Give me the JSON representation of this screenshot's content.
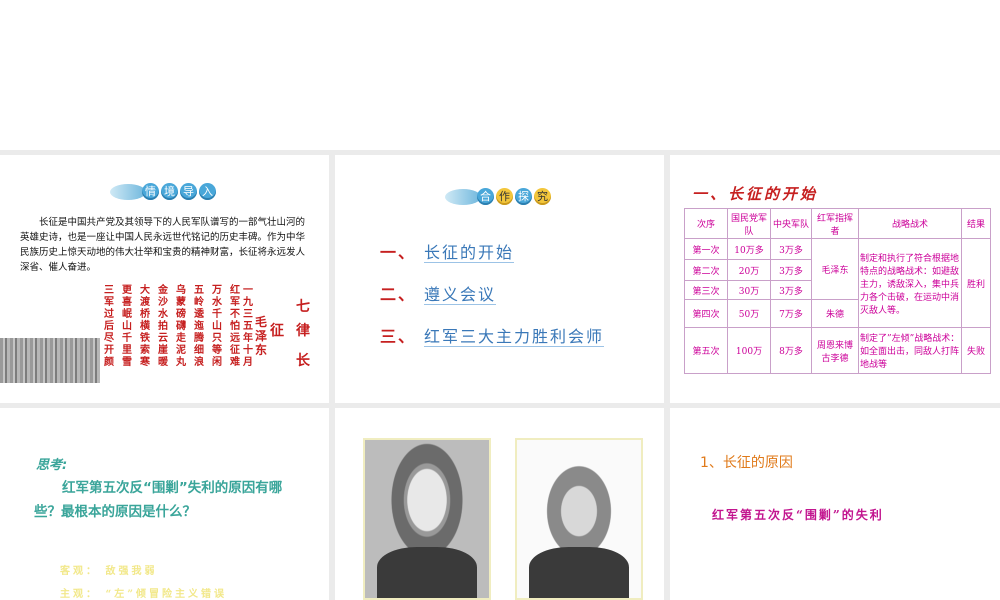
{
  "slide1": {
    "badge": [
      "情",
      "境",
      "导",
      "入"
    ],
    "intro": "长征是中国共产党及其领导下的人民军队谱写的一部气壮山河的英雄史诗，也是一座让中国人民永远世代铭记的历史丰碑。作为中华民族历史上惊天动地的伟大壮举和宝贵的精神财富，长征将永远发人深省、催人奋进。",
    "poem_title_a": "七律",
    "poem_title_b": "长征",
    "poem_author": "毛泽东",
    "poem_date": "一九三五年十月",
    "poem_lines": [
      "红军不怕远征难",
      "万水千山只等闲",
      "五岭逶迤腾细浪",
      "乌蒙磅礴走泥丸",
      "金沙水拍云崖暖",
      "大渡桥横铁索寒",
      "更喜岷山千里雪",
      "三军过后尽开颜"
    ]
  },
  "slide2": {
    "badge": [
      "合",
      "作",
      "探",
      "究"
    ],
    "items": [
      {
        "num": "一、",
        "text": "长征的开始"
      },
      {
        "num": "二、",
        "text": "遵义会议"
      },
      {
        "num": "三、",
        "text": "红军三大主力胜利会师"
      }
    ]
  },
  "slide3": {
    "title": "一、长征的开始",
    "headers": [
      "次序",
      "国民党军队",
      "中央军队",
      "红军指挥者",
      "战略战术",
      "结果"
    ],
    "rows": [
      {
        "order": "第一次",
        "kmt": "10万多",
        "central": "3万多"
      },
      {
        "order": "第二次",
        "kmt": "20万",
        "central": "3万多"
      },
      {
        "order": "第三次",
        "kmt": "30万",
        "central": "3万多"
      },
      {
        "order": "第四次",
        "kmt": "50万",
        "central": "7万多"
      },
      {
        "order": "第五次",
        "kmt": "100万",
        "central": "8万多"
      }
    ],
    "commander_mao": "毛泽东",
    "commander_zhu": "朱德",
    "commander_five": "周恩来博古李德",
    "tactics_good": "制定和执行了符合根据地特点的战略战术：如避敌主力，诱敌深入，集中兵力各个击破，在运动中消灭敌人等。",
    "tactics_bad": "制定了”左倾”战略战术：如全面出击，同敌人打阵地战等",
    "result_win": "胜利",
    "result_lose": "失败"
  },
  "slide4": {
    "think": "思考:",
    "question": "红军第五次反“围剿”失利的原因有哪些？最根本的原因是什么？",
    "faint1": "客观：  敌强我弱",
    "faint2": "主观：  “左”倾冒险主义错误"
  },
  "slide6": {
    "reason_title": "1、长征的原因",
    "reason_text": "红军第五次反“围剿”的失利"
  }
}
